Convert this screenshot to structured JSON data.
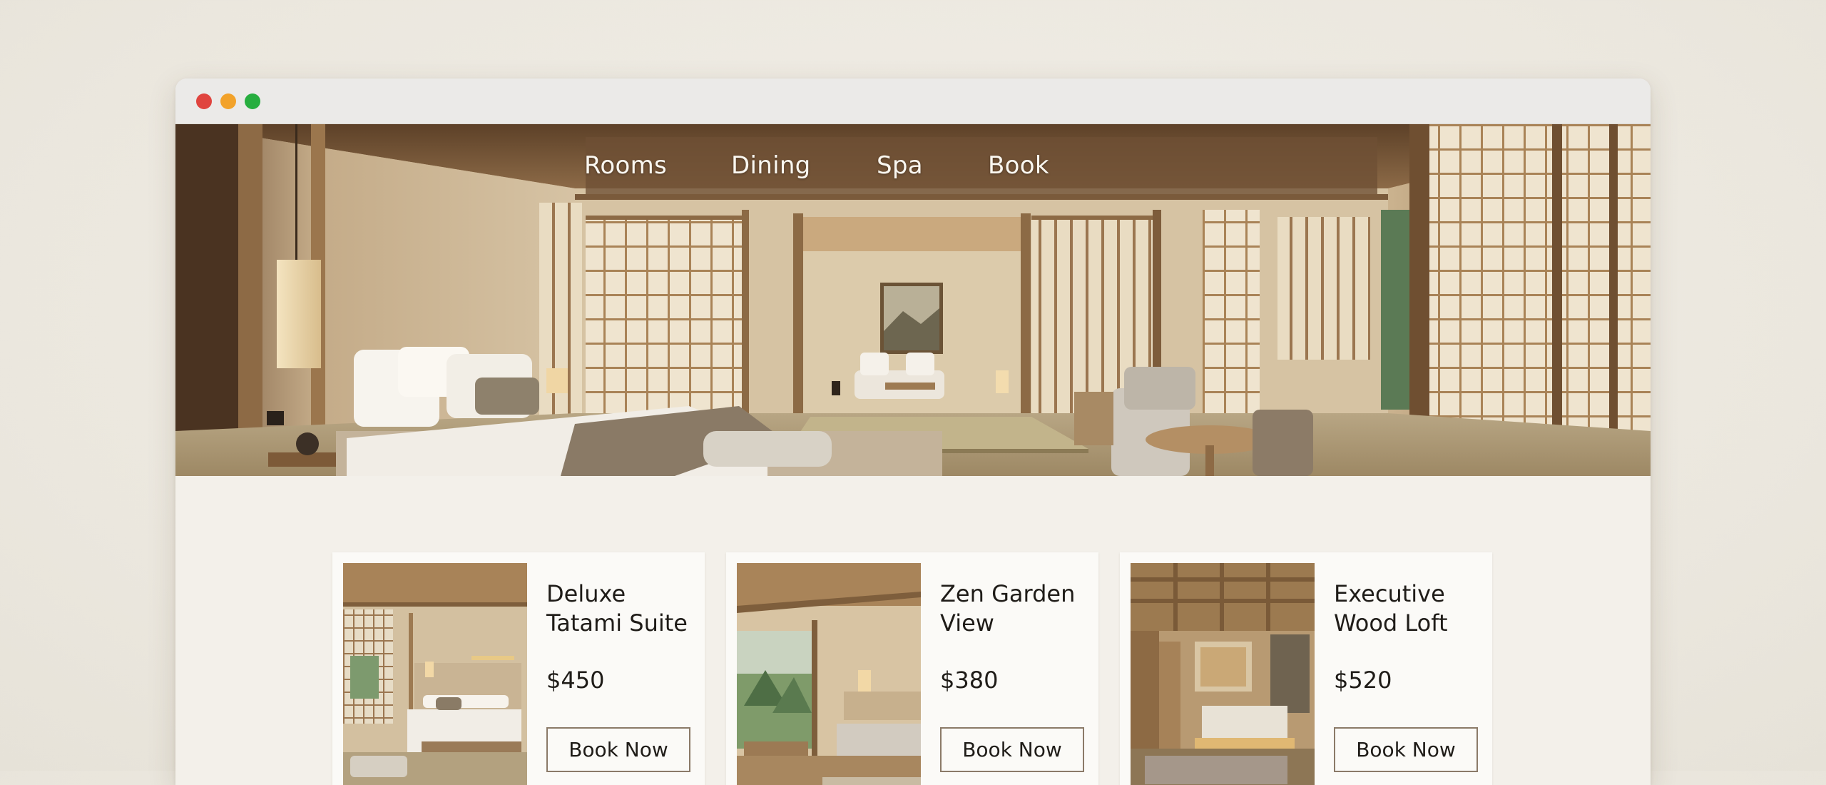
{
  "window": {
    "controls": [
      {
        "name": "close",
        "color": "#e0443e"
      },
      {
        "name": "minimize",
        "color": "#f2a22a"
      },
      {
        "name": "maximize",
        "color": "#27ae3f"
      }
    ]
  },
  "nav": {
    "links": [
      {
        "label": "Rooms"
      },
      {
        "label": "Dining"
      },
      {
        "label": "Spa"
      },
      {
        "label": "Book"
      }
    ]
  },
  "rooms": [
    {
      "title": "Deluxe Tatami Suite",
      "price": "$450",
      "button": "Book Now"
    },
    {
      "title": "Zen Garden View",
      "price": "$380",
      "button": "Book Now"
    },
    {
      "title": "Executive Wood Loft",
      "price": "$520",
      "button": "Book Now"
    }
  ],
  "colors": {
    "page_background": "#ece8e0",
    "content_background": "#f3f0ea",
    "card_background": "#fbfaf7",
    "wood": "#a07a52",
    "button_border": "#8b7a68"
  }
}
